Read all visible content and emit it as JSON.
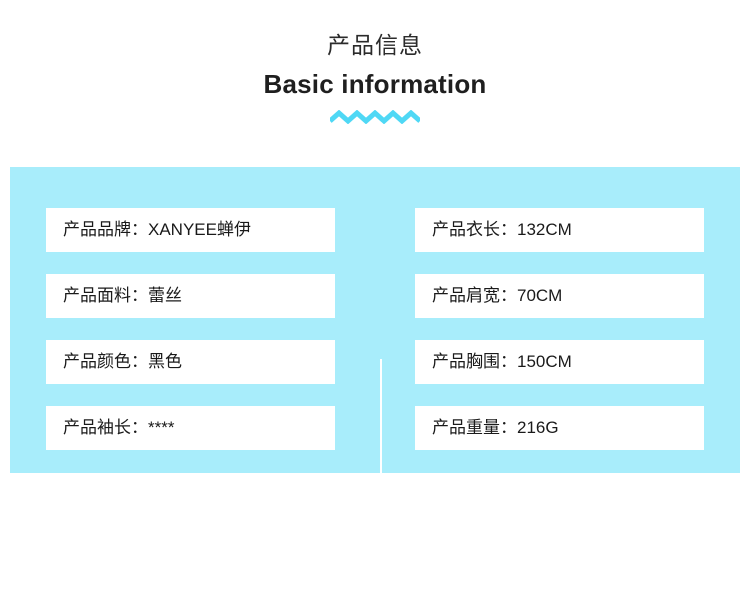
{
  "header": {
    "title_cn": "产品信息",
    "title_en": "Basic information",
    "divider_icon": "zigzag-wave",
    "accent_color": "#4fd8f5"
  },
  "panel": {
    "background_color": "#a8edfb",
    "divider_color": "#ffffff",
    "row_background_color": "#ffffff"
  },
  "info": {
    "left_column": [
      {
        "label": "产品品牌",
        "value": "XANYEE蝉伊",
        "text": "产品品牌：XANYEE蝉伊"
      },
      {
        "label": "产品面料",
        "value": "蕾丝",
        "text": "产品面料：蕾丝"
      },
      {
        "label": "产品颜色",
        "value": "黑色",
        "text": "产品颜色：黑色"
      },
      {
        "label": "产品袖长",
        "value": "****",
        "text": "产品袖长：****"
      }
    ],
    "right_column": [
      {
        "label": "产品衣长",
        "value": "132CM",
        "text": "产品衣长：132CM"
      },
      {
        "label": "产品肩宽",
        "value": "70CM",
        "text": "产品肩宽：70CM"
      },
      {
        "label": "产品胸围",
        "value": "150CM",
        "text": "产品胸围：150CM"
      },
      {
        "label": "产品重量",
        "value": "216G",
        "text": "产品重量：216G"
      }
    ]
  }
}
